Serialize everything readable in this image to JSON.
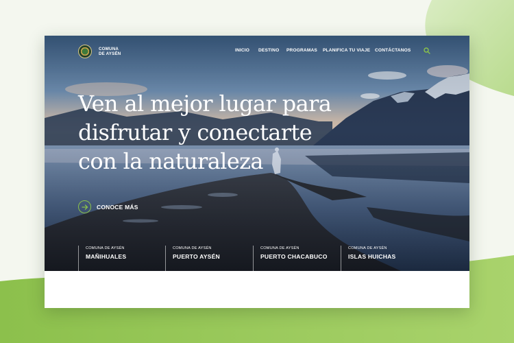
{
  "brand": {
    "line1": "COMUNA",
    "line2": "DE AYSÉN"
  },
  "nav": {
    "items": [
      "INICIO",
      "DESTINO",
      "PROGRAMAS",
      "PLANIFICA TU VIAJE",
      "CONTÁCTANOS"
    ],
    "search_icon": "search-icon"
  },
  "hero": {
    "headline_lines": [
      "Ven al mejor lugar para",
      "disfrutar y conectarte",
      "con la naturaleza"
    ],
    "cta_label": "CONOCE MÁS",
    "cta_icon": "arrow-right-icon"
  },
  "destinations": [
    {
      "kicker": "COMUNA DE AYSÉN",
      "name": "MAÑIHUALES"
    },
    {
      "kicker": "COMUNA DE AYSÉN",
      "name": "PUERTO AYSÉN"
    },
    {
      "kicker": "COMUNA DE AYSÉN",
      "name": "PUERTO CHACABUCO"
    },
    {
      "kicker": "COMUNA DE AYSÉN",
      "name": "ISLAS HUICHAS"
    }
  ],
  "colors": {
    "accent_green": "#8bc34a",
    "background_green": "#9bc95a",
    "page_background": "#f4f7ef"
  }
}
